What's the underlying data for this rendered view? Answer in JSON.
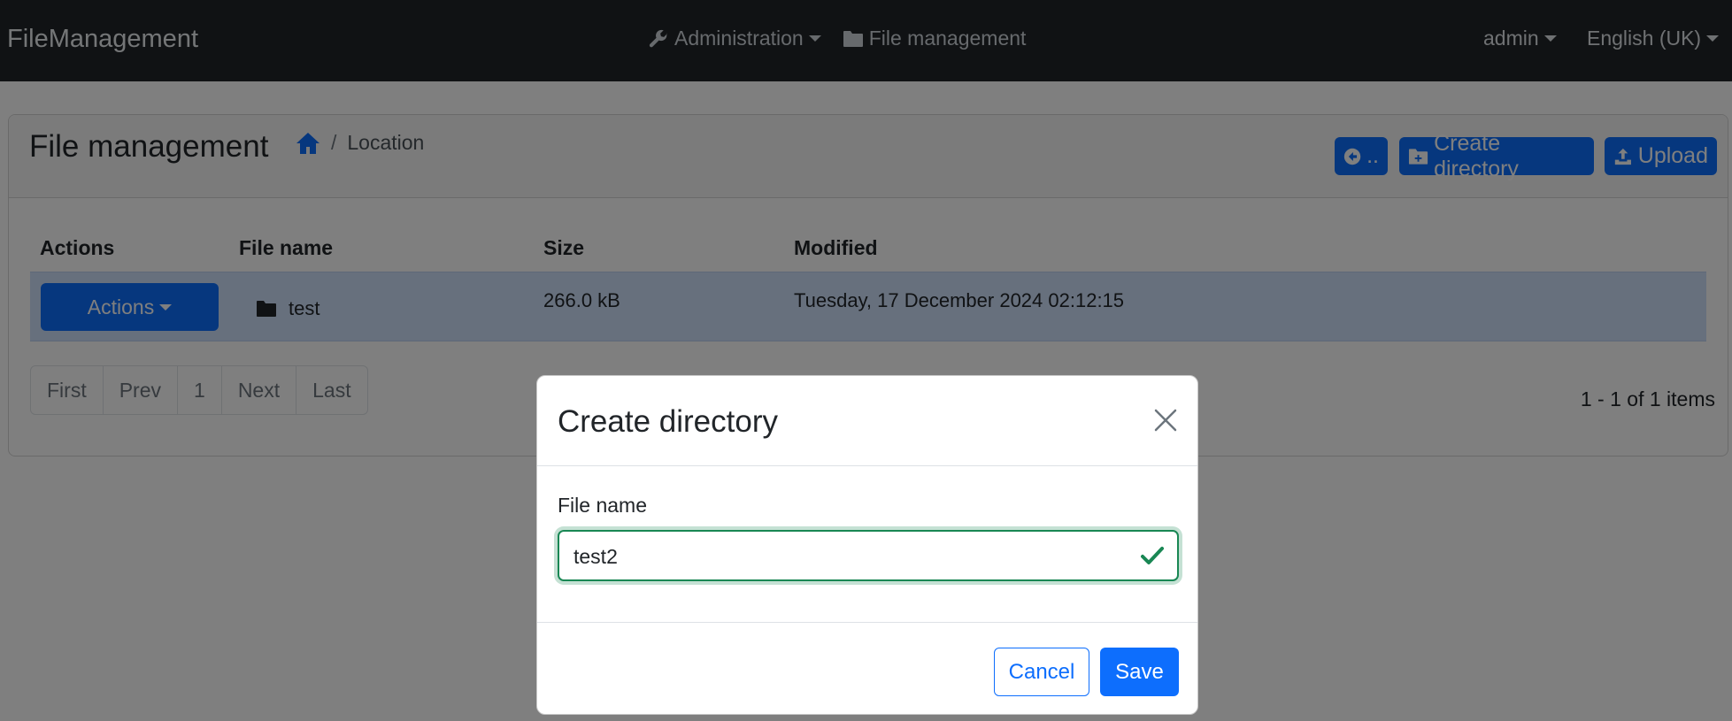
{
  "navbar": {
    "brand": "FileManagement",
    "administration": "Administration",
    "file_management": "File management",
    "user": "admin",
    "language": "English (UK)"
  },
  "page": {
    "title": "File management",
    "breadcrumb_location": "Location",
    "back_label": "..",
    "create_directory_label": "Create directory",
    "upload_label": "Upload"
  },
  "table": {
    "headers": [
      "Actions",
      "File name",
      "Size",
      "Modified"
    ],
    "rows": [
      {
        "actions_label": "Actions",
        "file_name": "test",
        "size": "266.0 kB",
        "modified": "Tuesday, 17 December 2024 02:12:15"
      }
    ]
  },
  "pagination": {
    "first": "First",
    "prev": "Prev",
    "page": "1",
    "next": "Next",
    "last": "Last",
    "summary": "1 - 1 of 1 items"
  },
  "modal": {
    "title": "Create directory",
    "field_label": "File name",
    "field_value": "test2",
    "cancel_label": "Cancel",
    "save_label": "Save"
  },
  "colors": {
    "primary": "#0d6efd",
    "success": "#198754",
    "navbar": "#212529"
  }
}
